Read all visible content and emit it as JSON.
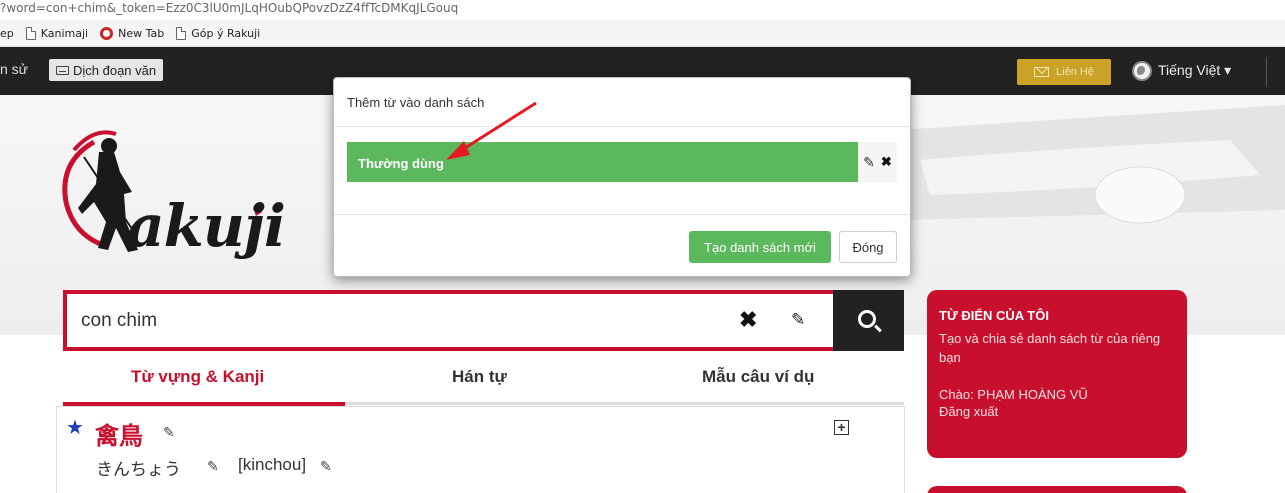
{
  "browser": {
    "url_fragment": "?word=con+chim&_token=Ezz0C3lU0mJLqHOubQPovzDzZ4ffTcDMKqJLGouq",
    "bookmarks": [
      {
        "label": "ep",
        "icon": "none"
      },
      {
        "label": "Kanimaji",
        "icon": "document-icon"
      },
      {
        "label": "New Tab",
        "icon": "newtab-icon"
      },
      {
        "label": "Góp ý Rakuji",
        "icon": "document-icon"
      }
    ]
  },
  "navbar": {
    "history_label": "n sử",
    "translate_label": "Dịch đoạn văn",
    "contact_label": "Liên Hệ",
    "language_label": "Tiếng Việt ▾"
  },
  "logo": {
    "text": "akuji"
  },
  "search": {
    "value": "con chim",
    "clear_icon": "✖",
    "edit_icon": "✎"
  },
  "tabs": [
    {
      "label": "Từ vựng & Kanji",
      "active": true
    },
    {
      "label": "Hán tự",
      "active": false
    },
    {
      "label": "Mẫu câu ví dụ",
      "active": false
    }
  ],
  "result": {
    "word": "禽鳥",
    "reading": "きんちょう",
    "romaji": "[kinchou]",
    "edit_icon": "✎",
    "plus_label": "+"
  },
  "sidebar_panel": {
    "title": "TỪ ĐIỂN CỦA TÔI",
    "description": "Tạo và chia sẻ danh sách từ của riêng bạn",
    "greeting": "Chào: PHẠM HOÀNG VŨ",
    "logout": "Đăng xuất"
  },
  "modal": {
    "title": "Thêm từ vào danh sách",
    "list_items": [
      {
        "label": "Thường dùng"
      }
    ],
    "edit_icon": "✎",
    "delete_icon": "✖",
    "create_button": "Tạo danh sách mới",
    "close_button": "Đóng"
  },
  "colors": {
    "brand_red": "#c8102e",
    "success_green": "#5cb85c",
    "navbar_dark": "#222222",
    "contact_gold": "#c9a227"
  }
}
